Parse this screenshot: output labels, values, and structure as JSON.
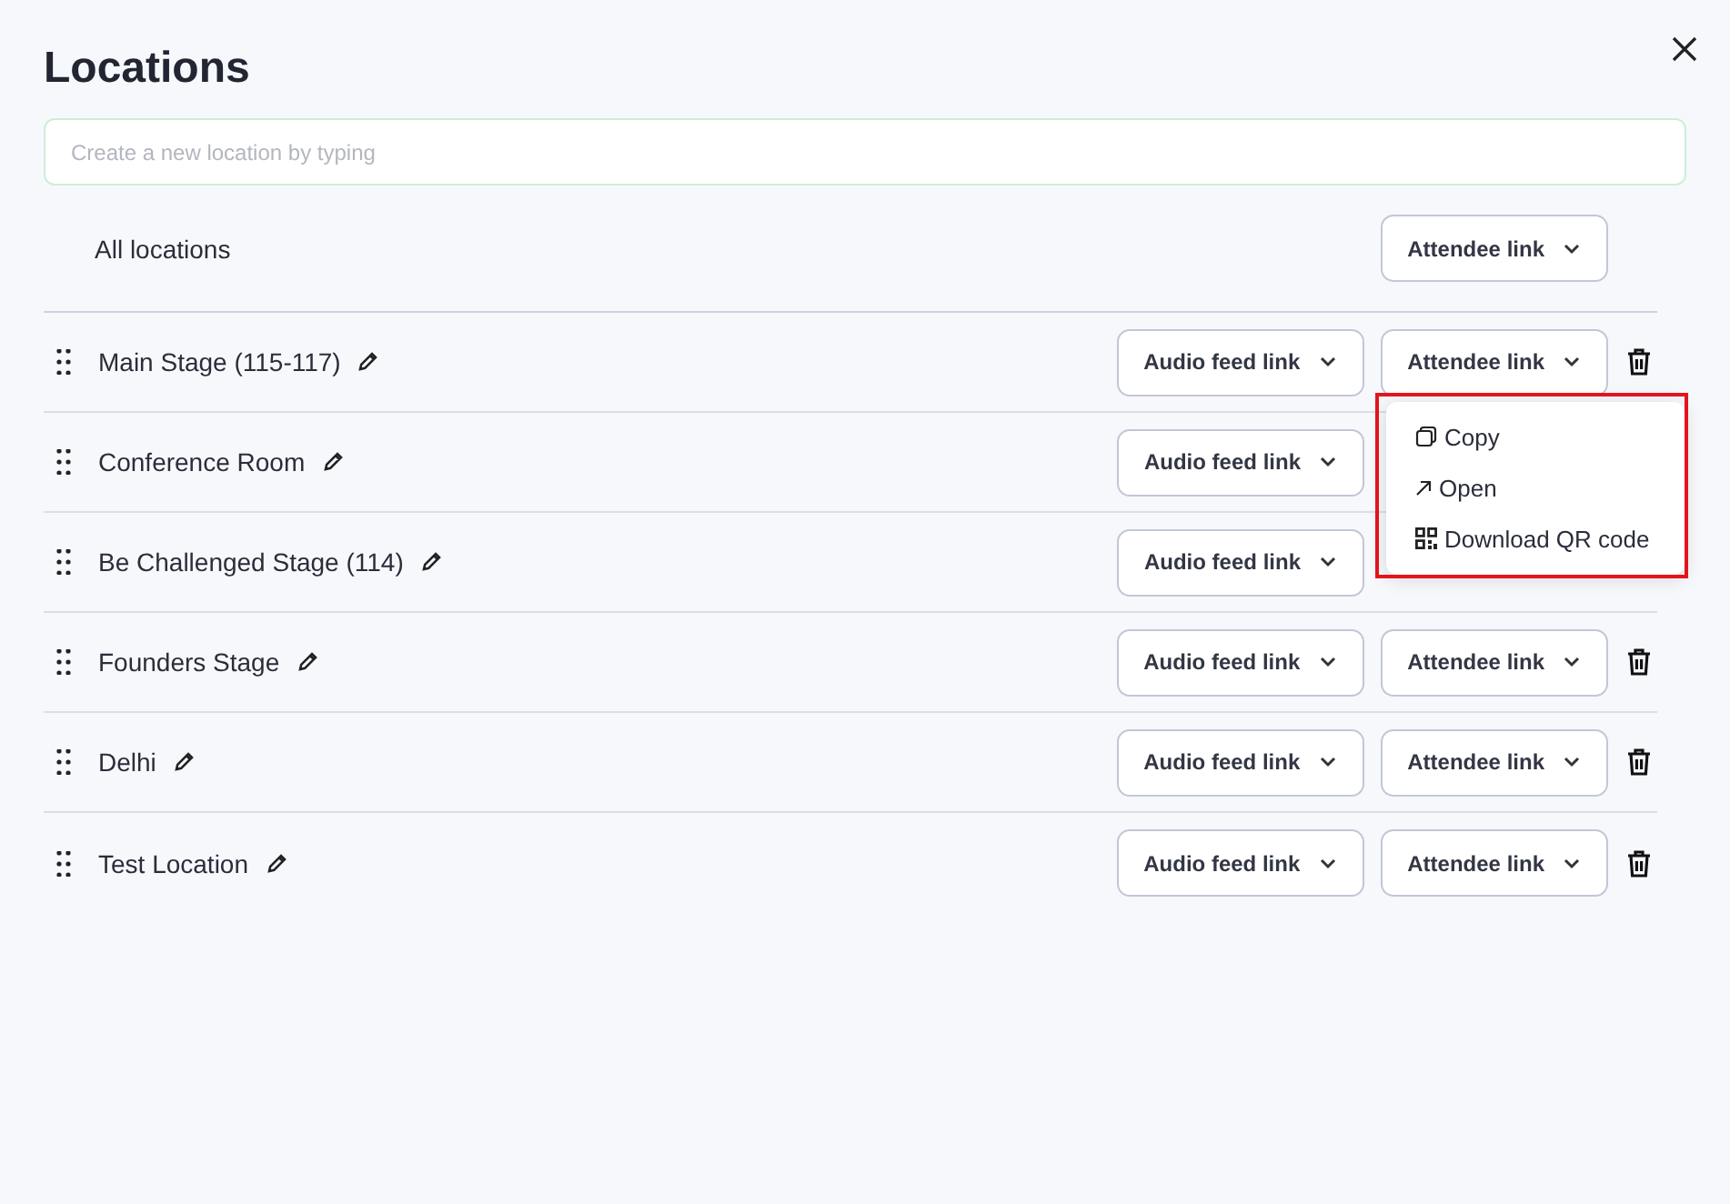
{
  "dialog": {
    "title": "Locations"
  },
  "new_location": {
    "placeholder": "Create a new location by typing"
  },
  "all_locations": {
    "label": "All locations",
    "attendee_button": "Attendee link"
  },
  "rows": [
    {
      "name": "Main Stage (115-117)",
      "audio_button": "Audio feed link",
      "attendee_button": "Attendee link",
      "delete": true
    },
    {
      "name": "Conference Room",
      "audio_button": "Audio feed link"
    },
    {
      "name": "Be Challenged Stage (114)",
      "audio_button": "Audio feed link"
    },
    {
      "name": "Founders Stage",
      "audio_button": "Audio feed link",
      "attendee_button": "Attendee link",
      "delete": true
    },
    {
      "name": "Delhi",
      "audio_button": "Audio feed link",
      "attendee_button": "Attendee link",
      "delete": true
    },
    {
      "name": "Test Location",
      "audio_button": "Audio feed link",
      "attendee_button": "Attendee link",
      "delete": true
    }
  ],
  "menu": {
    "highlighted": true,
    "items": [
      {
        "kind": "copy",
        "label": "Copy"
      },
      {
        "kind": "open",
        "label": "Open"
      },
      {
        "kind": "qr",
        "label": "Download QR code"
      }
    ]
  }
}
